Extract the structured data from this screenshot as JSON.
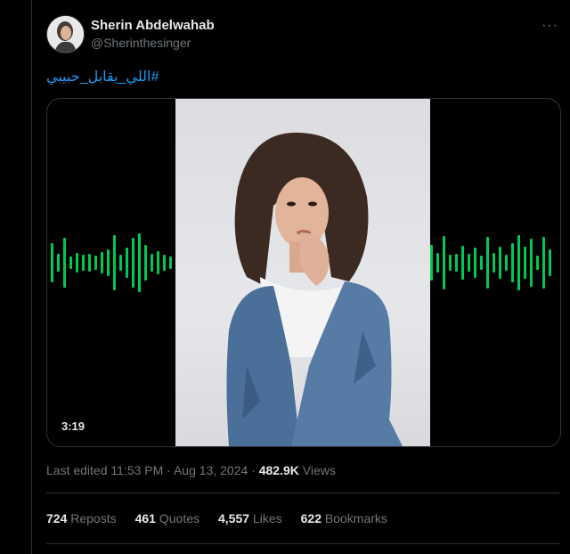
{
  "tweet": {
    "author_name": "Sherin Abdelwahab",
    "author_handle": "@Sherinthesinger",
    "more_label": "···",
    "hashtag": "#اللي_يقابل_حبيبي",
    "media": {
      "duration": "3:19",
      "accent_color": "#00c853"
    },
    "meta": {
      "prefix": "Last edited",
      "time": "11:53 PM",
      "separator": "·",
      "date": "Aug 13, 2024",
      "views_count": "482.9K",
      "views_label": "Views"
    },
    "stats": [
      {
        "num": "724",
        "label": "Reposts"
      },
      {
        "num": "461",
        "label": "Quotes"
      },
      {
        "num": "4,557",
        "label": "Likes"
      },
      {
        "num": "622",
        "label": "Bookmarks"
      }
    ]
  },
  "colors": {
    "background": "#000000",
    "text_primary": "#e7e9ea",
    "text_secondary": "#71767b",
    "link": "#1d9bf0",
    "border": "#2f3336"
  },
  "icons": [
    "more-icon"
  ]
}
